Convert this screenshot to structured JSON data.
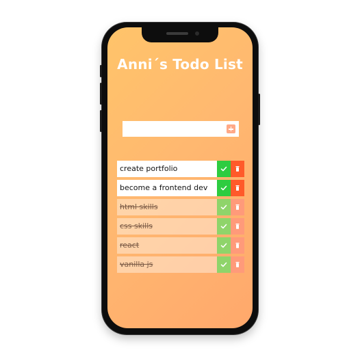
{
  "app": {
    "title": "Anni´s Todo List"
  },
  "input": {
    "placeholder": "",
    "value": ""
  },
  "todos": [
    {
      "text": "create portfolio",
      "completed": false
    },
    {
      "text": "become a frontend dev",
      "completed": false
    },
    {
      "text": "html skills",
      "completed": true
    },
    {
      "text": "css skills",
      "completed": true
    },
    {
      "text": "react",
      "completed": true
    },
    {
      "text": "vanilla js",
      "completed": true
    }
  ],
  "colors": {
    "gradient_start": "#ffc46a",
    "gradient_end": "#ffa86c",
    "check": "#2ecc40",
    "delete": "#ff5a2a"
  },
  "icons": {
    "add": "plus-square-icon",
    "check": "check-icon",
    "delete": "trash-icon"
  }
}
